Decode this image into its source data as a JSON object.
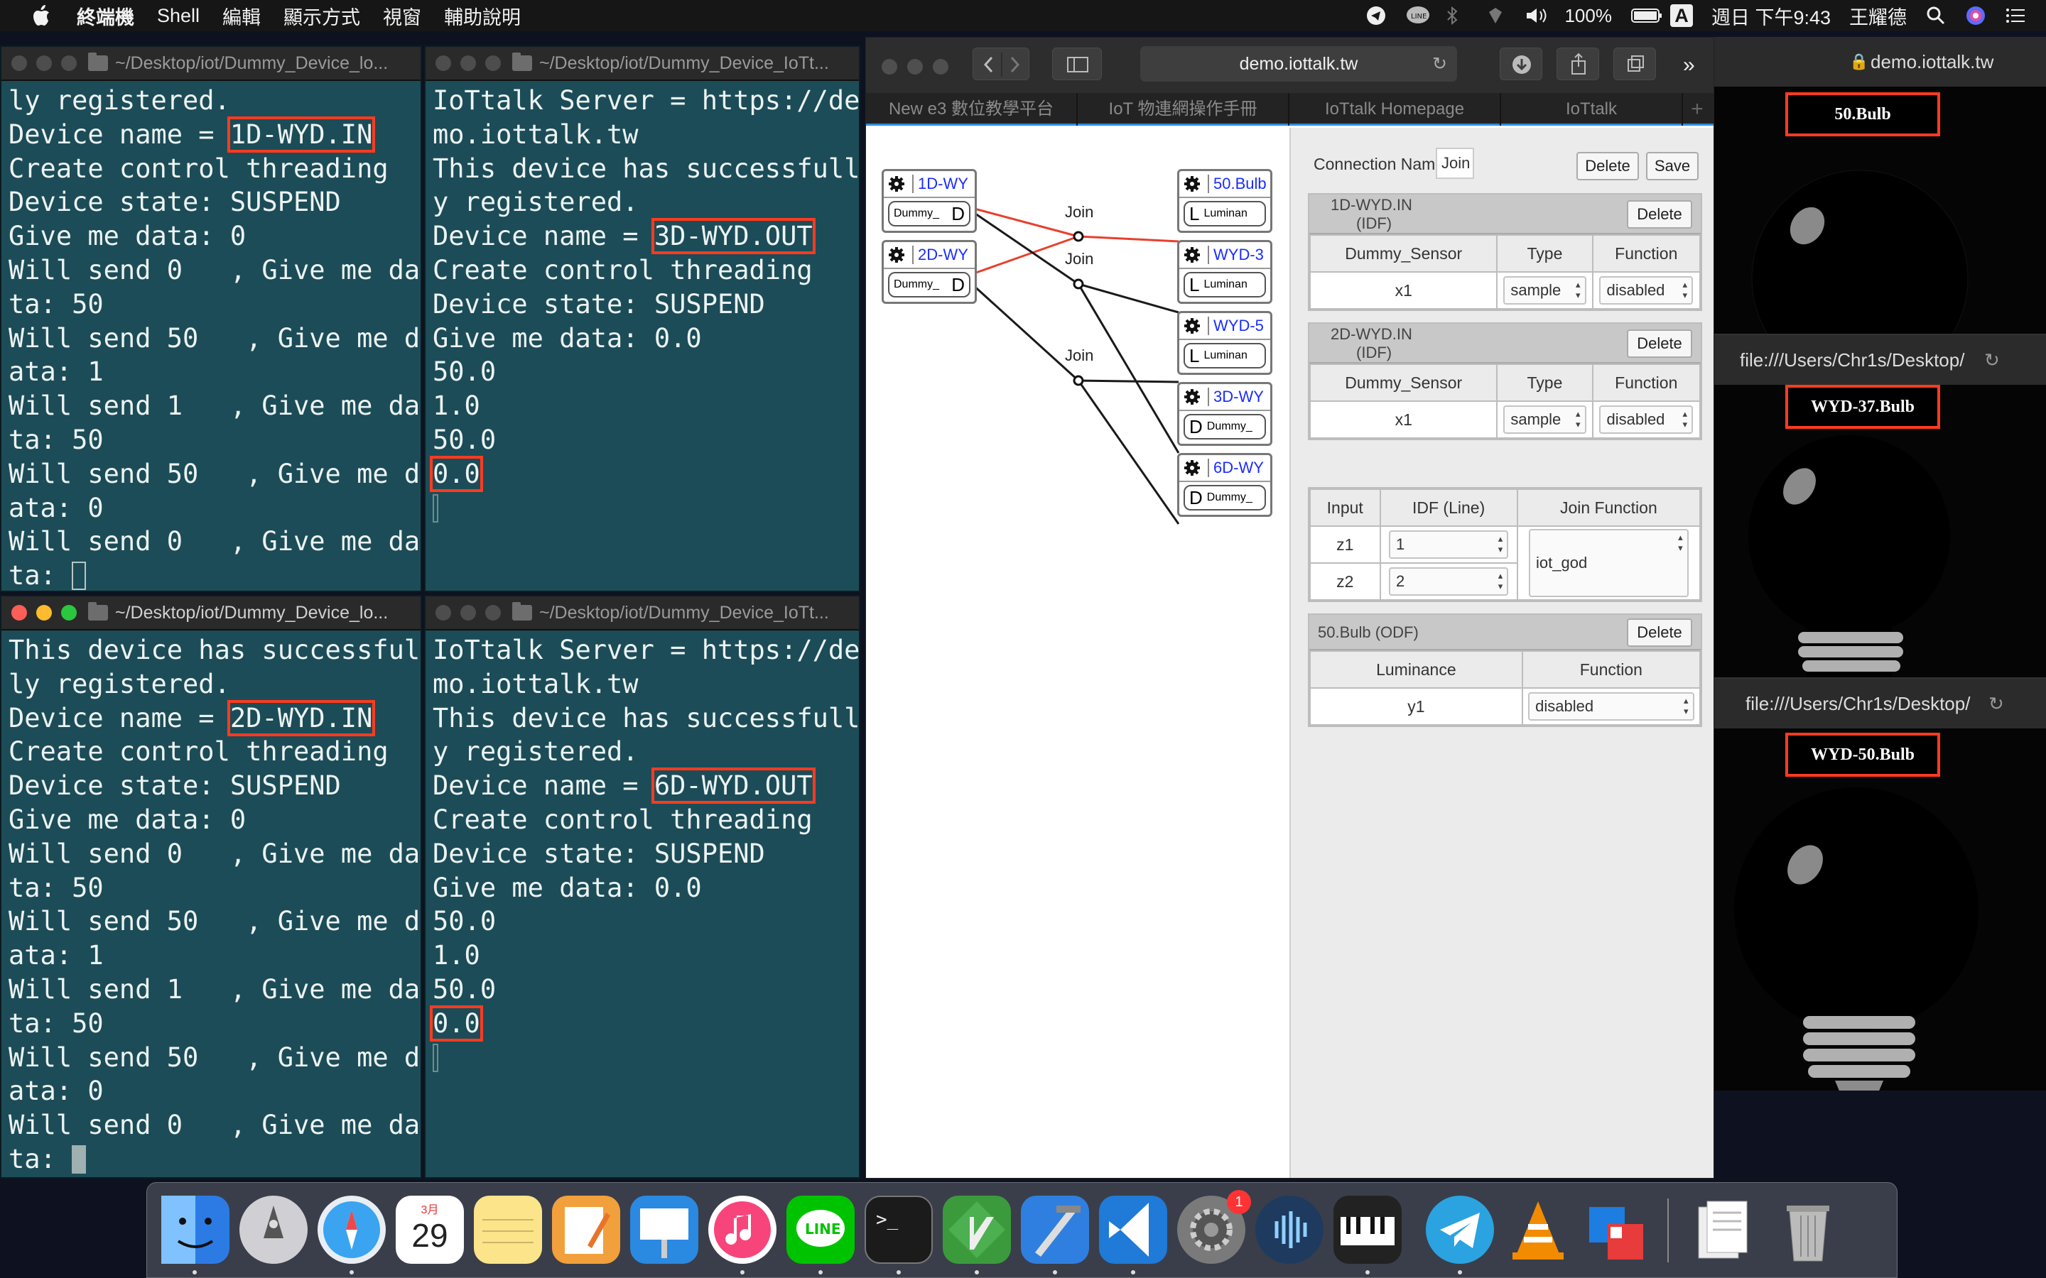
{
  "menubar": {
    "app_name": "終端機",
    "menus": [
      "Shell",
      "編輯",
      "顯示方式",
      "視窗",
      "輔助說明"
    ],
    "battery": "100%",
    "input_method": "A",
    "clock": "週日 下午9:43",
    "user": "王耀德"
  },
  "terminals": {
    "t1": {
      "title": "~/Desktop/iot/Dummy_Device_lo...",
      "lines": [
        "ly registered.",
        "Device name = |1D-WYD.IN|",
        "Create control threading",
        "Device state: SUSPEND",
        "Give me data: 0",
        "Will send 0   , Give me da",
        "ta: 50",
        "Will send 50   , Give me d",
        "ata: 1",
        "Will send 1   , Give me da",
        "ta: 50",
        "Will send 50   , Give me d",
        "ata: 0",
        "Will send 0   , Give me da",
        "ta: "
      ]
    },
    "t2": {
      "title": "~/Desktop/iot/Dummy_Device_IoTt...",
      "lines": [
        "IoTtalk Server = https://de",
        "mo.iottalk.tw",
        "This device has successfull",
        "y registered.",
        "Device name = |3D-WYD.OUT|",
        "Create control threading",
        "Device state: SUSPEND",
        "Give me data: 0.0",
        "50.0",
        "1.0",
        "50.0",
        "|0.0|",
        ""
      ]
    },
    "t3": {
      "title": "~/Desktop/iot/Dummy_Device_lo...",
      "lines": [
        "This device has successful",
        "ly registered.",
        "Device name = |2D-WYD.IN|",
        "Create control threading",
        "Device state: SUSPEND",
        "Give me data: 0",
        "Will send 0   , Give me da",
        "ta: 50",
        "Will send 50   , Give me d",
        "ata: 1",
        "Will send 1   , Give me da",
        "ta: 50",
        "Will send 50   , Give me d",
        "ata: 0",
        "Will send 0   , Give me da",
        "ta: "
      ]
    },
    "t4": {
      "title": "~/Desktop/iot/Dummy_Device_IoTt...",
      "lines": [
        "IoTtalk Server = https://de",
        "mo.iottalk.tw",
        "This device has successfull",
        "y registered.",
        "Device name = |6D-WYD.OUT|",
        "Create control threading",
        "Device state: SUSPEND",
        "Give me data: 0.0",
        "50.0",
        "1.0",
        "50.0",
        "|0.0|",
        ""
      ]
    }
  },
  "browser": {
    "url": "demo.iottalk.tw",
    "tabs": [
      "New e3 數位教學平台",
      "IoT 物連網操作手冊",
      "IoTtalk Homepage",
      "IoTtalk"
    ],
    "canvas": {
      "idf_devices": [
        {
          "name": "1D-WY",
          "feature": "Dummy_",
          "icon": "D"
        },
        {
          "name": "2D-WY",
          "feature": "Dummy_",
          "icon": "D"
        }
      ],
      "odf_devices": [
        {
          "name": "50.Bulb",
          "feature": "Luminan",
          "icon": "L"
        },
        {
          "name": "WYD-3",
          "feature": "Luminan",
          "icon": "L"
        },
        {
          "name": "WYD-5",
          "feature": "Luminan",
          "icon": "L"
        },
        {
          "name": "3D-WY",
          "feature": "Dummy_",
          "icon": "D"
        },
        {
          "name": "6D-WY",
          "feature": "Dummy_",
          "icon": "D"
        }
      ],
      "join_labels": [
        "Join",
        "Join",
        "Join"
      ],
      "link_colors": {
        "active": "#e8402c",
        "inactive": "#1a1a1a"
      }
    },
    "panel": {
      "connection_label": "Connection Name:",
      "connection_value": "Join",
      "delete_label": "Delete",
      "save_label": "Save",
      "idf1": {
        "title": "1D-WYD.IN",
        "subtitle": "(IDF)",
        "cols": [
          "Dummy_Sensor",
          "Type",
          "Function"
        ],
        "row": [
          "x1",
          "sample",
          "disabled"
        ]
      },
      "idf2": {
        "title": "2D-WYD.IN",
        "subtitle": "(IDF)",
        "cols": [
          "Dummy_Sensor",
          "Type",
          "Function"
        ],
        "row": [
          "x1",
          "sample",
          "disabled"
        ]
      },
      "join": {
        "cols": [
          "Input",
          "IDF (Line)",
          "Join Function"
        ],
        "rows": [
          [
            "z1",
            "1"
          ],
          [
            "z2",
            "2"
          ]
        ],
        "function": "iot_god"
      },
      "odf": {
        "title": "50.Bulb (ODF)",
        "cols": [
          "Luminance",
          "Function"
        ],
        "row": [
          "y1",
          "disabled"
        ]
      }
    }
  },
  "bulbs": [
    {
      "url": "demo.iottalk.tw",
      "label": "50.Bulb"
    },
    {
      "url": "file:///Users/Chr1s/Desktop/",
      "label": "WYD-37.Bulb"
    },
    {
      "url": "file:///Users/Chr1s/Desktop/",
      "label": "WYD-50.Bulb"
    }
  ],
  "dock": {
    "calendar_month": "3月",
    "calendar_day": "29",
    "badge": "1"
  }
}
